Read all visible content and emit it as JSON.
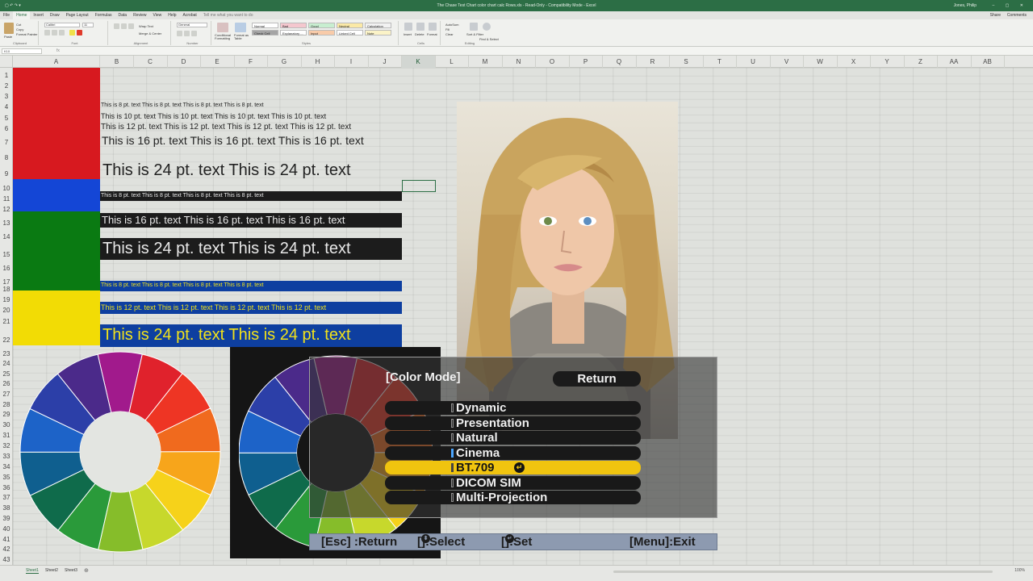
{
  "window": {
    "title": "The Chase Test Chart color chart calc Rows.xls - Read-Only - Compatibility Mode - Excel",
    "user": "Jones, Philip",
    "controls": "– ▢ ✕",
    "qat": "▢ ↶ ↷ ▾"
  },
  "ribbon_tabs": [
    "File",
    "Home",
    "Insert",
    "Draw",
    "Page Layout",
    "Formulas",
    "Data",
    "Review",
    "View",
    "Help",
    "Acrobat"
  ],
  "tell_me": "Tell me what you want to do",
  "share_label": "Share",
  "comments_label": "Comments",
  "ribbon": {
    "clipboard": {
      "label": "Clipboard",
      "paste": "Paste",
      "cut": "Cut",
      "copy": "Copy",
      "format_painter": "Format Painter"
    },
    "font": {
      "label": "Font",
      "name": "Calibri",
      "size": "11"
    },
    "alignment": {
      "label": "Alignment",
      "wrap": "Wrap Text",
      "merge": "Merge & Center"
    },
    "number": {
      "label": "Number",
      "format": "General"
    },
    "styles": {
      "label": "Styles",
      "conditional": "Conditional Formatting",
      "format_table": "Format as Table",
      "tiles": [
        {
          "label": "Normal",
          "color": "#ffffff"
        },
        {
          "label": "Bad",
          "color": "#f4c7ce"
        },
        {
          "label": "Good",
          "color": "#c8eed0"
        },
        {
          "label": "Neutral",
          "color": "#fbe9a6"
        },
        {
          "label": "Calculation",
          "color": "#f2f2f2"
        },
        {
          "label": "Check Cell",
          "color": "#a5a5a5"
        },
        {
          "label": "Explanatory ...",
          "color": "#ffffff"
        },
        {
          "label": "Input",
          "color": "#f8cba9"
        },
        {
          "label": "Linked Cell",
          "color": "#ffffff"
        },
        {
          "label": "Note",
          "color": "#fbf3c7"
        }
      ]
    },
    "cells": {
      "label": "Cells",
      "insert": "Insert",
      "delete": "Delete",
      "format": "Format"
    },
    "editing": {
      "label": "Editing",
      "autosum": "AutoSum",
      "fill": "Fill",
      "clear": "Clear",
      "sort": "Sort & Filter",
      "find": "Find & Select"
    }
  },
  "name_box": "K10",
  "fx_label": "fx",
  "columns": [
    "A",
    "B",
    "C",
    "D",
    "E",
    "F",
    "G",
    "H",
    "I",
    "J",
    "K",
    "L",
    "M",
    "N",
    "O",
    "P",
    "Q",
    "R",
    "S",
    "T",
    "U",
    "V",
    "W",
    "X",
    "Y",
    "Z",
    "AA",
    "AB"
  ],
  "selected_column": "K",
  "rows": [
    "1",
    "2",
    "3",
    "4",
    "5",
    "6",
    "7",
    "8",
    "9",
    "10",
    "11",
    "12",
    "13",
    "14",
    "15",
    "16",
    "17",
    "18",
    "19",
    "20",
    "21",
    "22",
    "23",
    "24",
    "25",
    "26",
    "27",
    "28",
    "29",
    "30",
    "31",
    "32",
    "33",
    "34",
    "35",
    "36",
    "37",
    "38",
    "39",
    "40",
    "41",
    "42",
    "43"
  ],
  "text_samples": {
    "r4": "This is 8 pt. text   This is 8 pt. text   This is 8 pt. text   This is 8 pt. text",
    "r6": "This is 10 pt. text   This is 10 pt. text   This is 10 pt. text   This is 10 pt. text",
    "r7": "This is 12 pt. text   This is 12 pt. text   This is 12 pt. text   This is 12 pt. text",
    "r8": "This is 16 pt. text   This is 16 pt. text   This is 16 pt. text",
    "r9": "This is 24 pt. text   This is 24 pt. text",
    "r11": "This is 8 pt. text   This is 8 pt. text   This is 8 pt. text   This is 8 pt. text",
    "r13": "This is 16 pt. text   This is 16 pt. text   This is 16 pt. text",
    "r15": "This is 24 pt. text   This is 24 pt. text",
    "r18": "This is 8 pt. text   This is 8 pt. text   This is 8 pt. text   This is 8 pt. text",
    "r20": "This is 12 pt. text   This is 12 pt. text   This is 12 pt. text   This is 12 pt. text",
    "r22": "This is 24 pt. text   This is 24 pt. text"
  },
  "swatches": [
    {
      "name": "red",
      "color": "#d7191f"
    },
    {
      "name": "blue",
      "color": "#1446d6"
    },
    {
      "name": "green",
      "color": "#0a7a12"
    },
    {
      "name": "yellow",
      "color": "#f2dc05"
    }
  ],
  "wheel_colors": [
    "#a11a8c",
    "#e0222c",
    "#ee3524",
    "#f06a1e",
    "#f7a51b",
    "#f6d21a",
    "#c7d82c",
    "#86bd2a",
    "#2a9a3a",
    "#0f6b4b",
    "#0f5f8f",
    "#1d63c8",
    "#2c3fa8",
    "#4b2a8a"
  ],
  "projector_menu": {
    "heading": "[Color Mode]",
    "return_label": "Return",
    "items": [
      {
        "label": "Dynamic",
        "on": false
      },
      {
        "label": "Presentation",
        "on": false
      },
      {
        "label": "Natural",
        "on": false
      },
      {
        "label": "Cinema",
        "on": true
      },
      {
        "label": "BT.709",
        "on": false,
        "selected": true
      },
      {
        "label": "DICOM SIM",
        "on": false
      },
      {
        "label": "Multi-Projection",
        "on": false
      }
    ],
    "footer": {
      "esc": "[Esc] :Return",
      "select_pre": "[",
      "select_post": "]:Select",
      "set_pre": "[",
      "set_post": "]:Set",
      "menu": "[Menu]:Exit",
      "updown_glyph": "⬍",
      "enter_glyph": "↵"
    }
  },
  "sheets": [
    "Sheet1",
    "Sheet2",
    "Sheet3"
  ],
  "add_sheet": "⊕",
  "zoom": "100%",
  "colors": {
    "excel_green": "#2c6e45",
    "highlight": "#f0c40f",
    "osd_footer": "#8d9ab0"
  }
}
